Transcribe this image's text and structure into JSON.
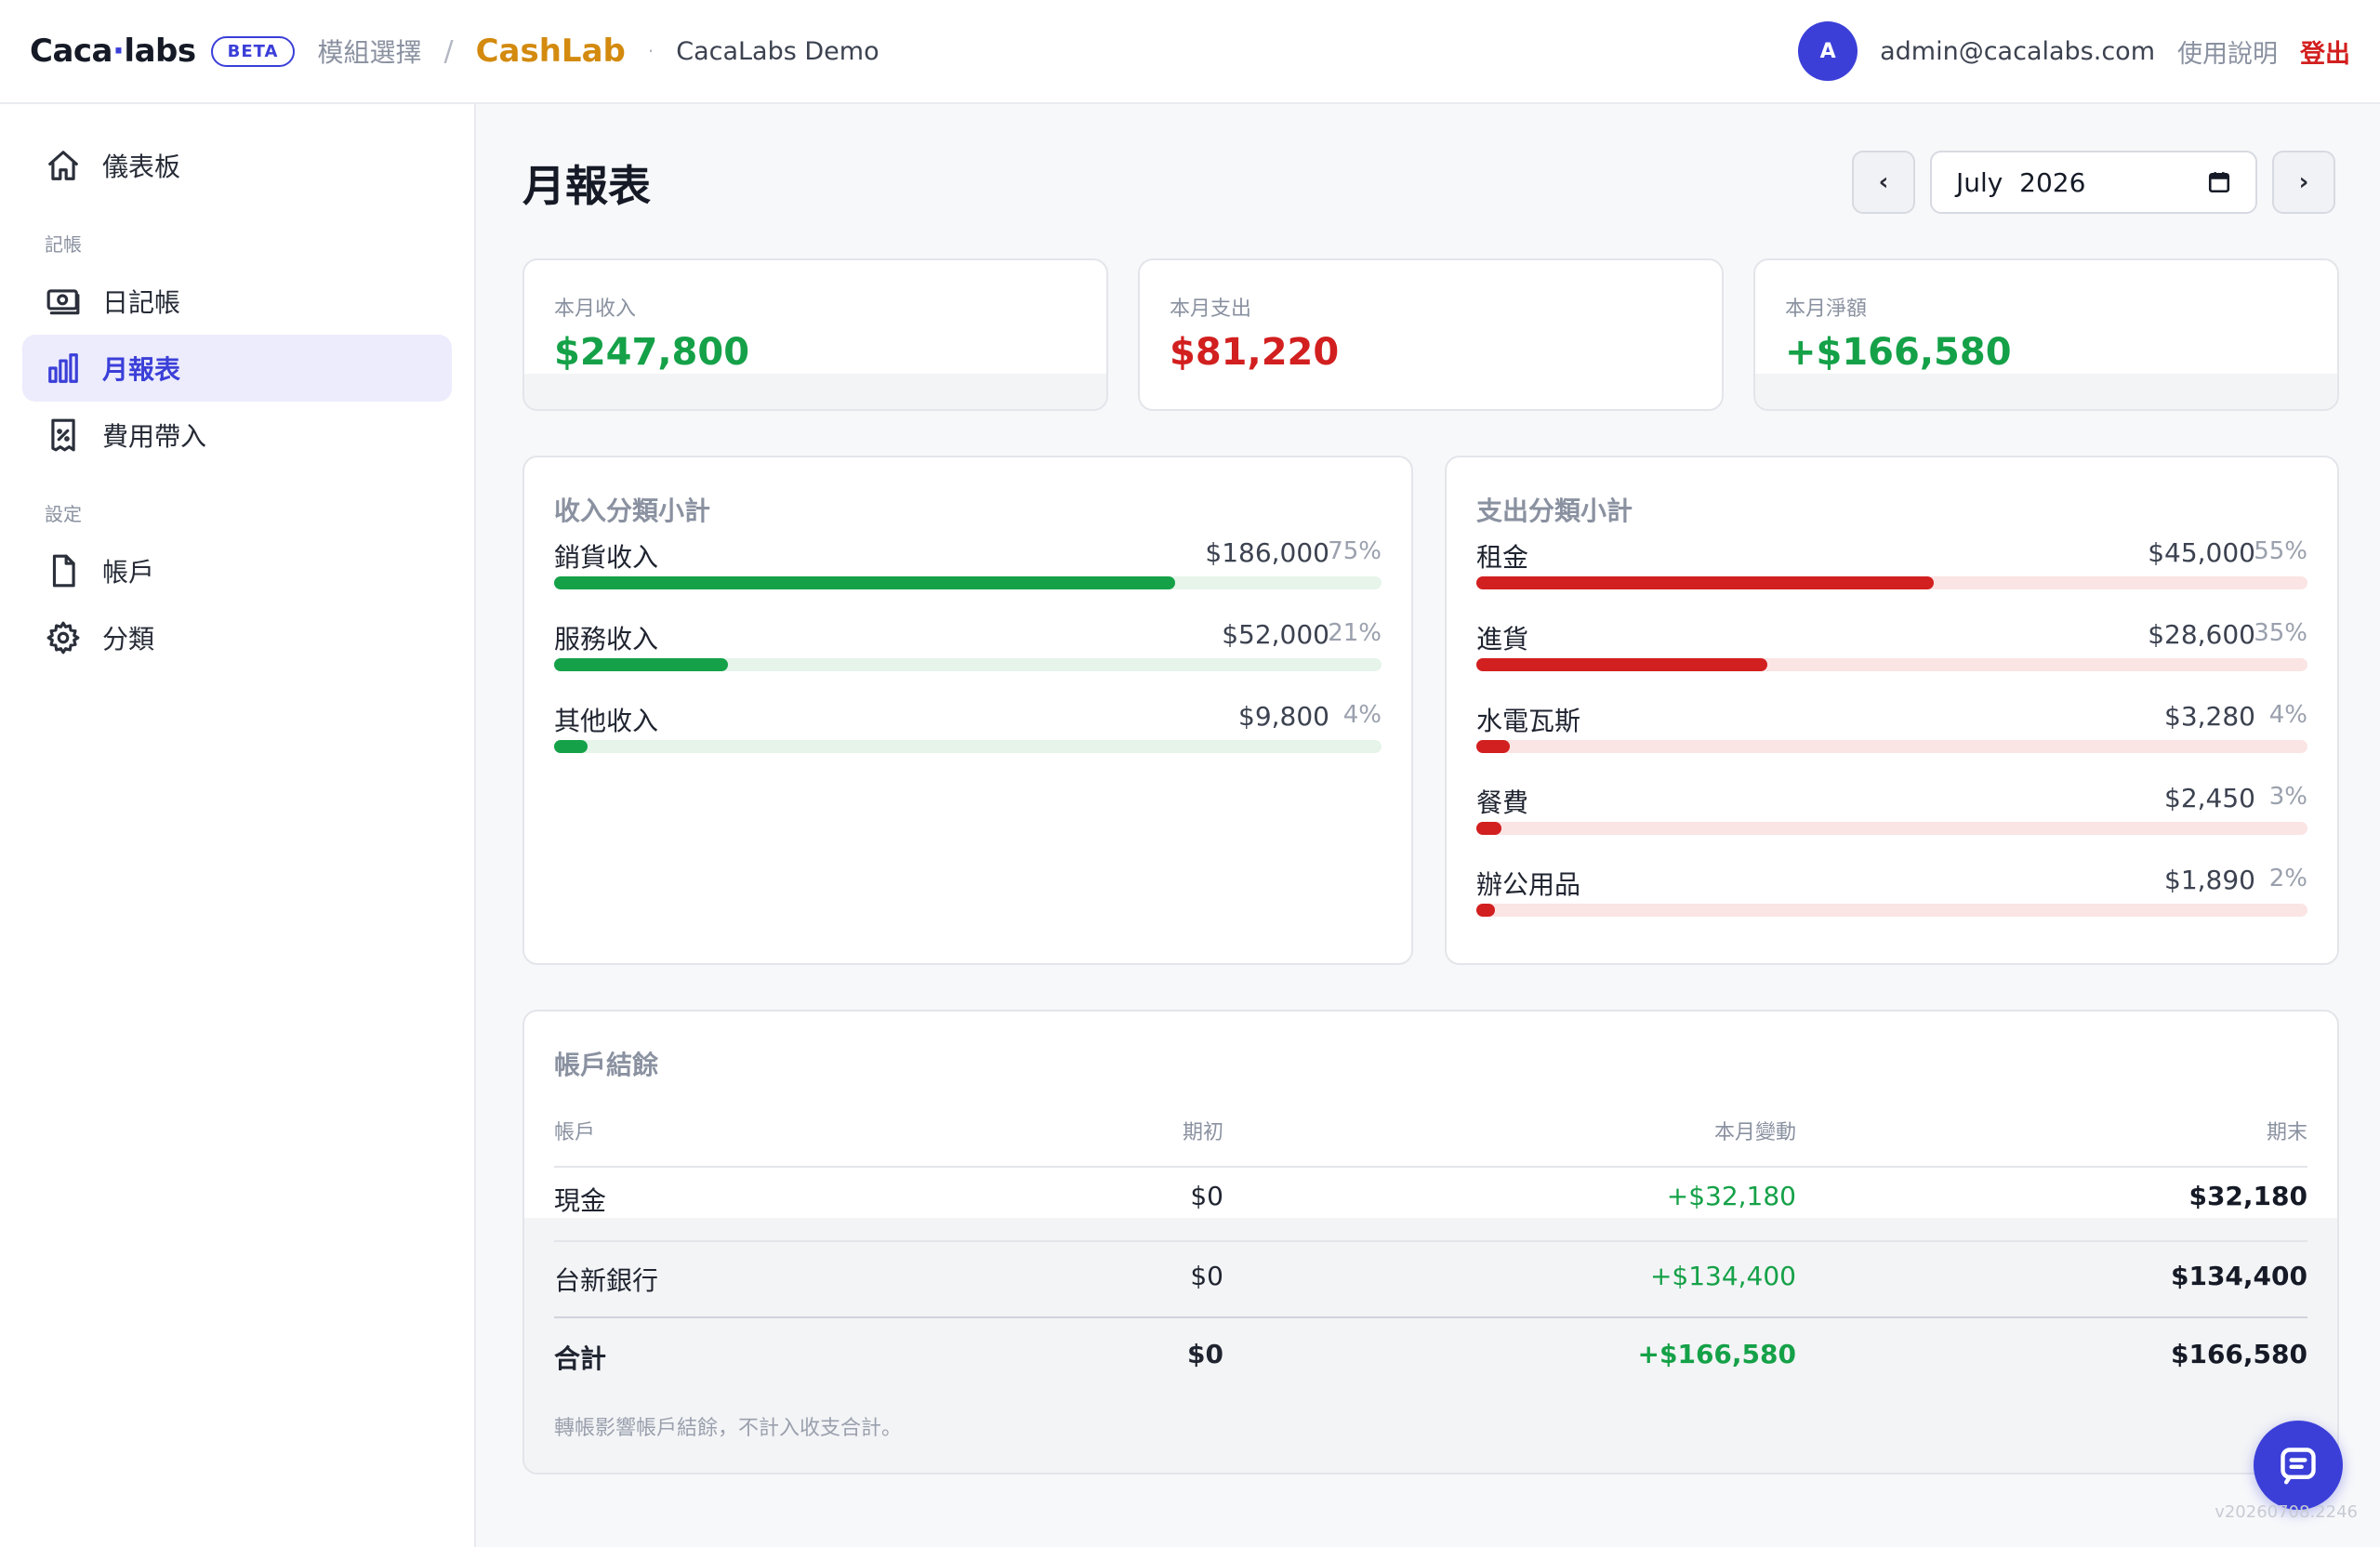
{
  "header": {
    "logo_left": "Caca",
    "logo_dot": "·",
    "logo_right": "labs",
    "beta": "BETA",
    "module_select": "模組選擇",
    "separator": "/",
    "app_name": "CashLab",
    "dot": "·",
    "tenant": "CacaLabs Demo",
    "avatar_initial": "A",
    "email": "admin@cacalabs.com",
    "help": "使用說明",
    "logout": "登出"
  },
  "sidebar": {
    "dashboard": "儀表板",
    "section_ledger": "記帳",
    "journal": "日記帳",
    "monthly_report": "月報表",
    "expense_import": "費用帶入",
    "section_settings": "設定",
    "accounts": "帳戶",
    "categories": "分類"
  },
  "page": {
    "title": "月報表",
    "prev": "‹",
    "next": "›",
    "month_value": "July  2026"
  },
  "summary": {
    "income_label": "本月收入",
    "income_value": "$247,800",
    "expense_label": "本月支出",
    "expense_value": "$81,220",
    "net_label": "本月淨額",
    "net_value": "+$166,580"
  },
  "income_breakdown": {
    "title": "收入分類小計",
    "items": [
      {
        "name": "銷貨收入",
        "amount": "$186,000",
        "percent": "75%",
        "fraction": 0.75
      },
      {
        "name": "服務收入",
        "amount": "$52,000",
        "percent": "21%",
        "fraction": 0.21
      },
      {
        "name": "其他收入",
        "amount": "$9,800",
        "percent": "4%",
        "fraction": 0.04
      }
    ]
  },
  "expense_breakdown": {
    "title": "支出分類小計",
    "items": [
      {
        "name": "租金",
        "amount": "$45,000",
        "percent": "55%",
        "fraction": 0.55
      },
      {
        "name": "進貨",
        "amount": "$28,600",
        "percent": "35%",
        "fraction": 0.35
      },
      {
        "name": "水電瓦斯",
        "amount": "$3,280",
        "percent": "4%",
        "fraction": 0.04
      },
      {
        "name": "餐費",
        "amount": "$2,450",
        "percent": "3%",
        "fraction": 0.03
      },
      {
        "name": "辦公用品",
        "amount": "$1,890",
        "percent": "2%",
        "fraction": 0.02
      }
    ]
  },
  "balances": {
    "title": "帳戶結餘",
    "headers": {
      "account": "帳戶",
      "opening": "期初",
      "change": "本月變動",
      "closing": "期末"
    },
    "rows": [
      {
        "account": "現金",
        "opening": "$0",
        "change": "+$32,180",
        "closing": "$32,180"
      },
      {
        "account": "台新銀行",
        "opening": "$0",
        "change": "+$134,400",
        "closing": "$134,400"
      }
    ],
    "total": {
      "account": "合計",
      "opening": "$0",
      "change": "+$166,580",
      "closing": "$166,580"
    },
    "note": "轉帳影響帳戶結餘，不計入收支合計。"
  },
  "footer": {
    "version": "v20260708.2246"
  },
  "colors": {
    "brand": "#3b3fd8",
    "app_accent": "#d38a0e",
    "income": "#15a148",
    "expense": "#d21f1f"
  },
  "icons": {
    "dashboard": "home-icon",
    "journal": "banknote-icon",
    "monthly_report": "bar-chart-icon",
    "expense_import": "receipt-icon",
    "accounts": "file-icon",
    "categories": "gear-icon",
    "chat": "chat-icon",
    "calendar": "calendar-icon"
  }
}
